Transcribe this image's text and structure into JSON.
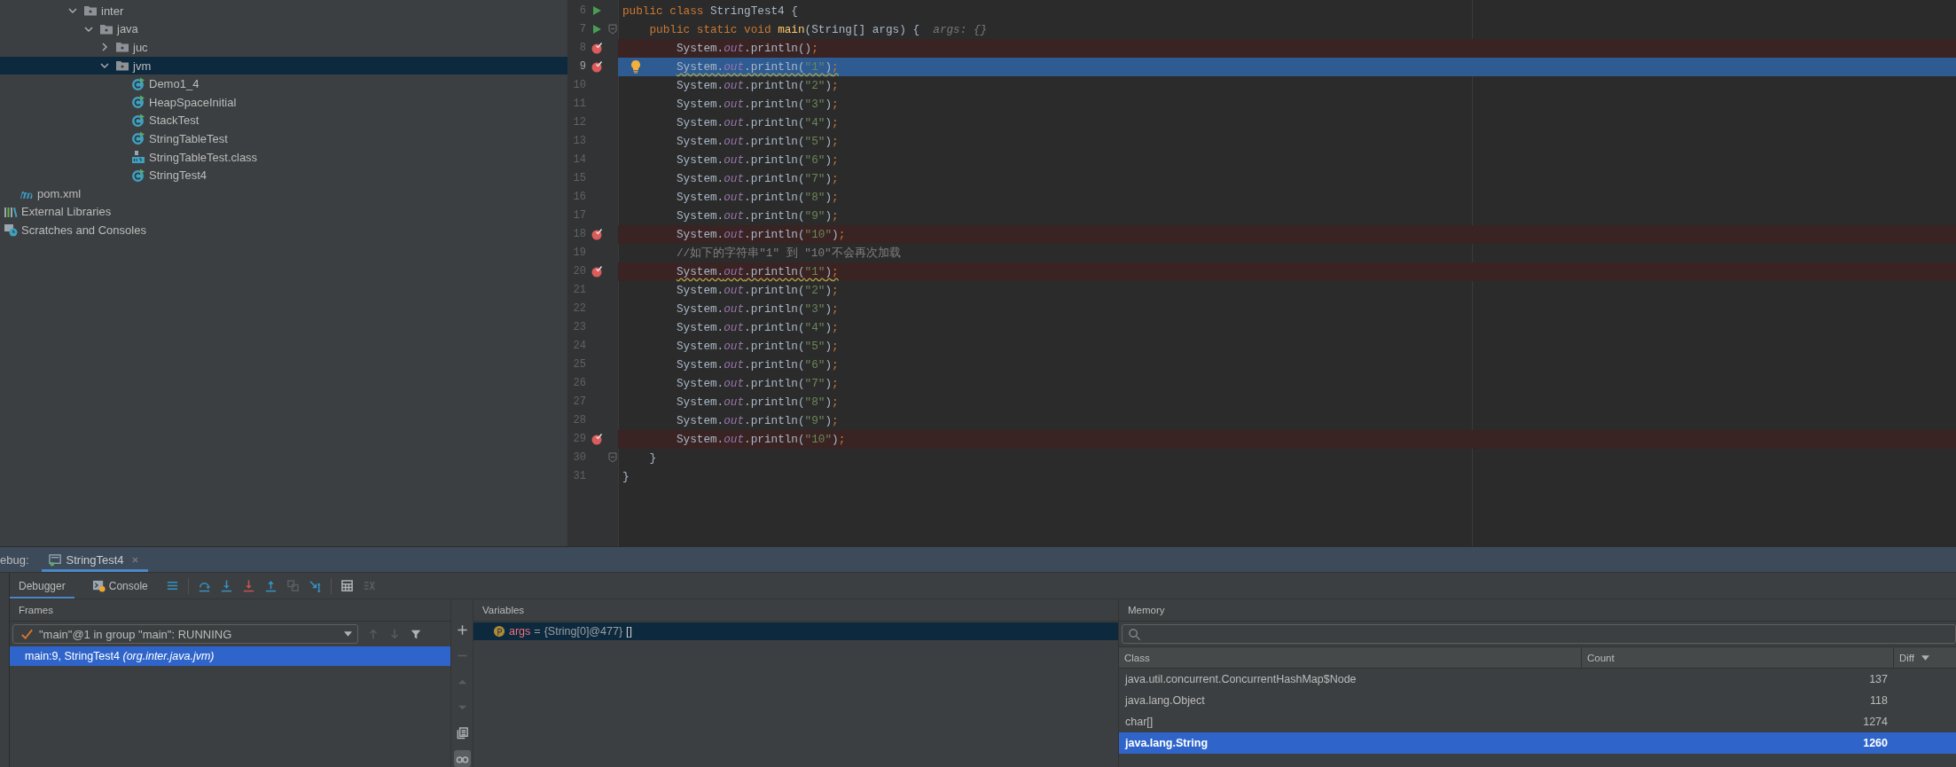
{
  "project_tree": [
    {
      "label": "inter",
      "kind": "folder",
      "expanded": true,
      "selected": false,
      "children": [
        {
          "label": "java",
          "kind": "folder",
          "expanded": true,
          "selected": false,
          "children": [
            {
              "label": "juc",
              "kind": "folder",
              "expanded": false,
              "selected": false
            },
            {
              "label": "jvm",
              "kind": "folder",
              "expanded": true,
              "selected": true,
              "children": [
                {
                  "label": "Demo1_4",
                  "kind": "class",
                  "selected": false
                },
                {
                  "label": "HeapSpaceInitial",
                  "kind": "class",
                  "selected": false
                },
                {
                  "label": "StackTest",
                  "kind": "class",
                  "selected": false
                },
                {
                  "label": "StringTableTest",
                  "kind": "class",
                  "selected": false
                },
                {
                  "label": "StringTableTest.class",
                  "kind": "classfile",
                  "selected": false
                },
                {
                  "label": "StringTest4",
                  "kind": "class",
                  "selected": false
                }
              ]
            }
          ]
        }
      ]
    },
    {
      "label": "pom.xml",
      "kind": "maven",
      "selected": false
    },
    {
      "label": "External Libraries",
      "kind": "libraries",
      "selected": false
    },
    {
      "label": "Scratches and Consoles",
      "kind": "scratches",
      "selected": false
    }
  ],
  "editor": {
    "lines": [
      {
        "number": "6",
        "run": true,
        "fold": false,
        "breakpoint": false,
        "current": false,
        "warning": false,
        "bulb": false,
        "tokens": [
          {
            "kind": "kw",
            "text": "public class "
          },
          {
            "kind": "plain",
            "text": "StringTest4 {"
          }
        ]
      },
      {
        "number": "7",
        "run": true,
        "fold": true,
        "breakpoint": false,
        "current": false,
        "warning": false,
        "bulb": false,
        "tokens": [
          {
            "kind": "kw",
            "text": "    public static void "
          },
          {
            "kind": "method",
            "text": "main"
          },
          {
            "kind": "plain",
            "text": "(String[] args) {  "
          },
          {
            "kind": "hint",
            "text": "args: {}"
          }
        ]
      },
      {
        "number": "8",
        "run": false,
        "fold": false,
        "breakpoint": true,
        "current": false,
        "warning": false,
        "bulb": false,
        "tokens": [
          {
            "kind": "plain",
            "text": "        System."
          },
          {
            "kind": "field",
            "text": "out"
          },
          {
            "kind": "plain",
            "text": ".println()"
          },
          {
            "kind": "punct",
            "text": ";"
          }
        ]
      },
      {
        "number": "9",
        "run": false,
        "fold": false,
        "breakpoint": true,
        "current": true,
        "warning": true,
        "bulb": true,
        "tokens": [
          {
            "kind": "plain",
            "text": "        System."
          },
          {
            "kind": "field",
            "text": "out"
          },
          {
            "kind": "plain",
            "text": ".println("
          },
          {
            "kind": "string",
            "text": "\"1\""
          },
          {
            "kind": "plain",
            "text": ")"
          },
          {
            "kind": "punct",
            "text": ";"
          }
        ]
      },
      {
        "number": "10",
        "run": false,
        "fold": false,
        "breakpoint": false,
        "current": false,
        "warning": false,
        "bulb": false,
        "tokens": [
          {
            "kind": "plain",
            "text": "        System."
          },
          {
            "kind": "field",
            "text": "out"
          },
          {
            "kind": "plain",
            "text": ".println("
          },
          {
            "kind": "string",
            "text": "\"2\""
          },
          {
            "kind": "plain",
            "text": ")"
          },
          {
            "kind": "punct",
            "text": ";"
          }
        ]
      },
      {
        "number": "11",
        "run": false,
        "fold": false,
        "breakpoint": false,
        "current": false,
        "warning": false,
        "bulb": false,
        "tokens": [
          {
            "kind": "plain",
            "text": "        System."
          },
          {
            "kind": "field",
            "text": "out"
          },
          {
            "kind": "plain",
            "text": ".println("
          },
          {
            "kind": "string",
            "text": "\"3\""
          },
          {
            "kind": "plain",
            "text": ")"
          },
          {
            "kind": "punct",
            "text": ";"
          }
        ]
      },
      {
        "number": "12",
        "run": false,
        "fold": false,
        "breakpoint": false,
        "current": false,
        "warning": false,
        "bulb": false,
        "tokens": [
          {
            "kind": "plain",
            "text": "        System."
          },
          {
            "kind": "field",
            "text": "out"
          },
          {
            "kind": "plain",
            "text": ".println("
          },
          {
            "kind": "string",
            "text": "\"4\""
          },
          {
            "kind": "plain",
            "text": ")"
          },
          {
            "kind": "punct",
            "text": ";"
          }
        ]
      },
      {
        "number": "13",
        "run": false,
        "fold": false,
        "breakpoint": false,
        "current": false,
        "warning": false,
        "bulb": false,
        "tokens": [
          {
            "kind": "plain",
            "text": "        System."
          },
          {
            "kind": "field",
            "text": "out"
          },
          {
            "kind": "plain",
            "text": ".println("
          },
          {
            "kind": "string",
            "text": "\"5\""
          },
          {
            "kind": "plain",
            "text": ")"
          },
          {
            "kind": "punct",
            "text": ";"
          }
        ]
      },
      {
        "number": "14",
        "run": false,
        "fold": false,
        "breakpoint": false,
        "current": false,
        "warning": false,
        "bulb": false,
        "tokens": [
          {
            "kind": "plain",
            "text": "        System."
          },
          {
            "kind": "field",
            "text": "out"
          },
          {
            "kind": "plain",
            "text": ".println("
          },
          {
            "kind": "string",
            "text": "\"6\""
          },
          {
            "kind": "plain",
            "text": ")"
          },
          {
            "kind": "punct",
            "text": ";"
          }
        ]
      },
      {
        "number": "15",
        "run": false,
        "fold": false,
        "breakpoint": false,
        "current": false,
        "warning": false,
        "bulb": false,
        "tokens": [
          {
            "kind": "plain",
            "text": "        System."
          },
          {
            "kind": "field",
            "text": "out"
          },
          {
            "kind": "plain",
            "text": ".println("
          },
          {
            "kind": "string",
            "text": "\"7\""
          },
          {
            "kind": "plain",
            "text": ")"
          },
          {
            "kind": "punct",
            "text": ";"
          }
        ]
      },
      {
        "number": "16",
        "run": false,
        "fold": false,
        "breakpoint": false,
        "current": false,
        "warning": false,
        "bulb": false,
        "tokens": [
          {
            "kind": "plain",
            "text": "        System."
          },
          {
            "kind": "field",
            "text": "out"
          },
          {
            "kind": "plain",
            "text": ".println("
          },
          {
            "kind": "string",
            "text": "\"8\""
          },
          {
            "kind": "plain",
            "text": ")"
          },
          {
            "kind": "punct",
            "text": ";"
          }
        ]
      },
      {
        "number": "17",
        "run": false,
        "fold": false,
        "breakpoint": false,
        "current": false,
        "warning": false,
        "bulb": false,
        "tokens": [
          {
            "kind": "plain",
            "text": "        System."
          },
          {
            "kind": "field",
            "text": "out"
          },
          {
            "kind": "plain",
            "text": ".println("
          },
          {
            "kind": "string",
            "text": "\"9\""
          },
          {
            "kind": "plain",
            "text": ")"
          },
          {
            "kind": "punct",
            "text": ";"
          }
        ]
      },
      {
        "number": "18",
        "run": false,
        "fold": false,
        "breakpoint": true,
        "current": false,
        "warning": false,
        "bulb": false,
        "tokens": [
          {
            "kind": "plain",
            "text": "        System."
          },
          {
            "kind": "field",
            "text": "out"
          },
          {
            "kind": "plain",
            "text": ".println("
          },
          {
            "kind": "string",
            "text": "\"10\""
          },
          {
            "kind": "plain",
            "text": ")"
          },
          {
            "kind": "punct",
            "text": ";"
          }
        ]
      },
      {
        "number": "19",
        "run": false,
        "fold": false,
        "breakpoint": false,
        "current": false,
        "warning": false,
        "bulb": false,
        "tokens": [
          {
            "kind": "comment",
            "text": "        //如下的字符串\"1\" 到 \"10\"不会再次加载"
          }
        ]
      },
      {
        "number": "20",
        "run": false,
        "fold": false,
        "breakpoint": true,
        "current": false,
        "warning": true,
        "bulb": false,
        "tokens": [
          {
            "kind": "plain",
            "text": "        System."
          },
          {
            "kind": "field",
            "text": "out"
          },
          {
            "kind": "plain",
            "text": ".println("
          },
          {
            "kind": "string",
            "text": "\"1\""
          },
          {
            "kind": "plain",
            "text": ")"
          },
          {
            "kind": "punct",
            "text": ";"
          }
        ]
      },
      {
        "number": "21",
        "run": false,
        "fold": false,
        "breakpoint": false,
        "current": false,
        "warning": false,
        "bulb": false,
        "tokens": [
          {
            "kind": "plain",
            "text": "        System."
          },
          {
            "kind": "field",
            "text": "out"
          },
          {
            "kind": "plain",
            "text": ".println("
          },
          {
            "kind": "string",
            "text": "\"2\""
          },
          {
            "kind": "plain",
            "text": ")"
          },
          {
            "kind": "punct",
            "text": ";"
          }
        ]
      },
      {
        "number": "22",
        "run": false,
        "fold": false,
        "breakpoint": false,
        "current": false,
        "warning": false,
        "bulb": false,
        "tokens": [
          {
            "kind": "plain",
            "text": "        System."
          },
          {
            "kind": "field",
            "text": "out"
          },
          {
            "kind": "plain",
            "text": ".println("
          },
          {
            "kind": "string",
            "text": "\"3\""
          },
          {
            "kind": "plain",
            "text": ")"
          },
          {
            "kind": "punct",
            "text": ";"
          }
        ]
      },
      {
        "number": "23",
        "run": false,
        "fold": false,
        "breakpoint": false,
        "current": false,
        "warning": false,
        "bulb": false,
        "tokens": [
          {
            "kind": "plain",
            "text": "        System."
          },
          {
            "kind": "field",
            "text": "out"
          },
          {
            "kind": "plain",
            "text": ".println("
          },
          {
            "kind": "string",
            "text": "\"4\""
          },
          {
            "kind": "plain",
            "text": ")"
          },
          {
            "kind": "punct",
            "text": ";"
          }
        ]
      },
      {
        "number": "24",
        "run": false,
        "fold": false,
        "breakpoint": false,
        "current": false,
        "warning": false,
        "bulb": false,
        "tokens": [
          {
            "kind": "plain",
            "text": "        System."
          },
          {
            "kind": "field",
            "text": "out"
          },
          {
            "kind": "plain",
            "text": ".println("
          },
          {
            "kind": "string",
            "text": "\"5\""
          },
          {
            "kind": "plain",
            "text": ")"
          },
          {
            "kind": "punct",
            "text": ";"
          }
        ]
      },
      {
        "number": "25",
        "run": false,
        "fold": false,
        "breakpoint": false,
        "current": false,
        "warning": false,
        "bulb": false,
        "tokens": [
          {
            "kind": "plain",
            "text": "        System."
          },
          {
            "kind": "field",
            "text": "out"
          },
          {
            "kind": "plain",
            "text": ".println("
          },
          {
            "kind": "string",
            "text": "\"6\""
          },
          {
            "kind": "plain",
            "text": ")"
          },
          {
            "kind": "punct",
            "text": ";"
          }
        ]
      },
      {
        "number": "26",
        "run": false,
        "fold": false,
        "breakpoint": false,
        "current": false,
        "warning": false,
        "bulb": false,
        "tokens": [
          {
            "kind": "plain",
            "text": "        System."
          },
          {
            "kind": "field",
            "text": "out"
          },
          {
            "kind": "plain",
            "text": ".println("
          },
          {
            "kind": "string",
            "text": "\"7\""
          },
          {
            "kind": "plain",
            "text": ")"
          },
          {
            "kind": "punct",
            "text": ";"
          }
        ]
      },
      {
        "number": "27",
        "run": false,
        "fold": false,
        "breakpoint": false,
        "current": false,
        "warning": false,
        "bulb": false,
        "tokens": [
          {
            "kind": "plain",
            "text": "        System."
          },
          {
            "kind": "field",
            "text": "out"
          },
          {
            "kind": "plain",
            "text": ".println("
          },
          {
            "kind": "string",
            "text": "\"8\""
          },
          {
            "kind": "plain",
            "text": ")"
          },
          {
            "kind": "punct",
            "text": ";"
          }
        ]
      },
      {
        "number": "28",
        "run": false,
        "fold": false,
        "breakpoint": false,
        "current": false,
        "warning": false,
        "bulb": false,
        "tokens": [
          {
            "kind": "plain",
            "text": "        System."
          },
          {
            "kind": "field",
            "text": "out"
          },
          {
            "kind": "plain",
            "text": ".println("
          },
          {
            "kind": "string",
            "text": "\"9\""
          },
          {
            "kind": "plain",
            "text": ")"
          },
          {
            "kind": "punct",
            "text": ";"
          }
        ]
      },
      {
        "number": "29",
        "run": false,
        "fold": false,
        "breakpoint": true,
        "current": false,
        "warning": false,
        "bulb": false,
        "tokens": [
          {
            "kind": "plain",
            "text": "        System."
          },
          {
            "kind": "field",
            "text": "out"
          },
          {
            "kind": "plain",
            "text": ".println("
          },
          {
            "kind": "string",
            "text": "\"10\""
          },
          {
            "kind": "plain",
            "text": ")"
          },
          {
            "kind": "punct",
            "text": ";"
          }
        ]
      },
      {
        "number": "30",
        "run": false,
        "fold": true,
        "breakpoint": false,
        "current": false,
        "warning": false,
        "bulb": false,
        "tokens": [
          {
            "kind": "plain",
            "text": "    }"
          }
        ]
      },
      {
        "number": "31",
        "run": false,
        "fold": false,
        "breakpoint": false,
        "current": false,
        "warning": false,
        "bulb": false,
        "tokens": [
          {
            "kind": "plain",
            "text": "}"
          }
        ]
      }
    ]
  },
  "debug": {
    "title": "ebug:",
    "tabs": [
      {
        "label": "StringTest4",
        "selected": true
      }
    ],
    "view_tabs": [
      {
        "label": "Debugger",
        "kind": "plain",
        "selected": true
      },
      {
        "label": "Console",
        "kind": "console",
        "selected": false
      }
    ],
    "toolbar": [
      {
        "kind": "lines",
        "disabled": false
      },
      {
        "kind": "step-over",
        "disabled": false
      },
      {
        "kind": "step-into",
        "disabled": false
      },
      {
        "kind": "force-step-into",
        "disabled": false
      },
      {
        "kind": "step-out",
        "disabled": false
      },
      {
        "kind": "drop-frame",
        "disabled": true
      },
      {
        "kind": "run-to-cursor",
        "disabled": false
      },
      {
        "kind": "calculator",
        "disabled": false
      },
      {
        "kind": "trace",
        "disabled": true
      }
    ],
    "frames": {
      "header": "Frames",
      "thread": "\"main\"@1 in group \"main\": RUNNING",
      "controls": [
        {
          "kind": "up",
          "disabled": true
        },
        {
          "kind": "down",
          "disabled": true
        },
        {
          "kind": "filter",
          "disabled": false
        }
      ],
      "items": [
        {
          "text": "main:9, StringTest4 *(org.inter.java.jvm)*",
          "selected": true
        }
      ]
    },
    "variables": {
      "header": "Variables",
      "controls": [
        {
          "kind": "plus",
          "disabled": false,
          "selected": false
        },
        {
          "kind": "minus",
          "disabled": true,
          "selected": false
        },
        {
          "kind": "tri-up",
          "disabled": true,
          "selected": false
        },
        {
          "kind": "tri-down",
          "disabled": true,
          "selected": false
        },
        {
          "kind": "copy",
          "disabled": false,
          "selected": false
        },
        {
          "kind": "glasses",
          "disabled": false,
          "selected": true
        }
      ],
      "items": [
        {
          "name": "args",
          "separator": "=",
          "value": "{String[0]@477}",
          "extra": "[]",
          "selected": true
        }
      ]
    },
    "memory": {
      "header": "Memory",
      "columns": [
        {
          "label": "Class",
          "sorted": false
        },
        {
          "label": "Count",
          "sorted": false
        },
        {
          "label": "Diff",
          "sorted": true
        }
      ],
      "rows": [
        {
          "class": "java.util.concurrent.ConcurrentHashMap$Node",
          "count": "137",
          "selected": false
        },
        {
          "class": "java.lang.Object",
          "count": "118",
          "selected": false
        },
        {
          "class": "char[]",
          "count": "1274",
          "selected": false
        },
        {
          "class": "java.lang.String",
          "count": "1260",
          "selected": true
        }
      ]
    }
  }
}
